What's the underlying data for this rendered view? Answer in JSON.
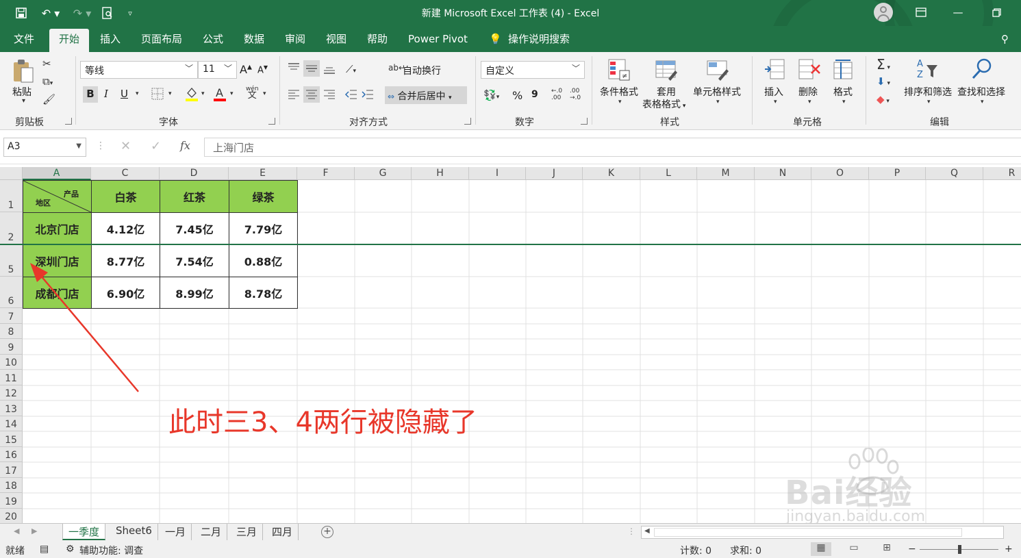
{
  "window": {
    "title": "新建 Microsoft Excel 工作表 (4)  -  Excel"
  },
  "ribbon": {
    "tabs": [
      "文件",
      "开始",
      "插入",
      "页面布局",
      "公式",
      "数据",
      "审阅",
      "视图",
      "帮助",
      "Power Pivot",
      "操作说明搜索"
    ],
    "active_tab": "开始",
    "clipboard": {
      "paste": "粘贴",
      "group": "剪贴板"
    },
    "font": {
      "name": "等线",
      "size": "11",
      "group": "字体",
      "bold": "B",
      "italic": "I",
      "underline": "U",
      "grow": "A",
      "shrink": "A",
      "phonetic_top": "wén",
      "phonetic_bottom": "文"
    },
    "alignment": {
      "wrap": "自动换行",
      "merge": "合并后居中",
      "group": "对齐方式"
    },
    "number": {
      "format": "自定义",
      "percent": "%",
      "comma": "9",
      "group": "数字"
    },
    "styles": {
      "conditional": "条件格式",
      "table_line1": "套用",
      "table_line2": "表格格式",
      "cell_styles": "单元格样式",
      "group": "样式"
    },
    "cells": {
      "insert": "插入",
      "delete": "删除",
      "format": "格式",
      "group": "单元格"
    },
    "editing": {
      "sort": "排序和筛选",
      "find": "查找和选择",
      "group": "编辑"
    }
  },
  "formula_bar": {
    "name_box": "A3",
    "content": "上海门店",
    "fx": "fx"
  },
  "grid": {
    "columns": [
      "A",
      "C",
      "D",
      "E",
      "F",
      "G",
      "H",
      "I",
      "J",
      "K",
      "L",
      "M",
      "N",
      "O",
      "P",
      "Q",
      "R"
    ],
    "rows": [
      "1",
      "2",
      "5",
      "6",
      "7",
      "8",
      "9",
      "10",
      "11",
      "12",
      "13",
      "14",
      "15",
      "16",
      "17",
      "18",
      "19",
      "20"
    ],
    "header_cell": {
      "top_right": "产品",
      "bottom_left": "地区"
    },
    "products": [
      "白茶",
      "红茶",
      "绿茶"
    ],
    "table_rows": [
      {
        "region": "北京门店",
        "values": [
          "4.12亿",
          "7.45亿",
          "7.79亿"
        ]
      },
      {
        "region": "深圳门店",
        "values": [
          "8.77亿",
          "7.54亿",
          "0.88亿"
        ]
      },
      {
        "region": "成都门店",
        "values": [
          "6.90亿",
          "8.99亿",
          "8.78亿"
        ]
      }
    ]
  },
  "annotation": "此时三3、4两行被隐藏了",
  "watermark": {
    "brand": "Bai经验",
    "url": "jingyan.baidu.com"
  },
  "sheets": {
    "tabs": [
      "一季度",
      "Sheet6",
      "一月",
      "二月",
      "三月",
      "四月"
    ],
    "active": "一季度"
  },
  "status": {
    "ready": "就绪",
    "accessibility": "辅助功能: 调查",
    "count": "计数: 0",
    "sum": "求和: 0"
  },
  "colors": {
    "brand_green": "#217346",
    "header_fill": "#92d050",
    "annotation_red": "#e8372a"
  }
}
